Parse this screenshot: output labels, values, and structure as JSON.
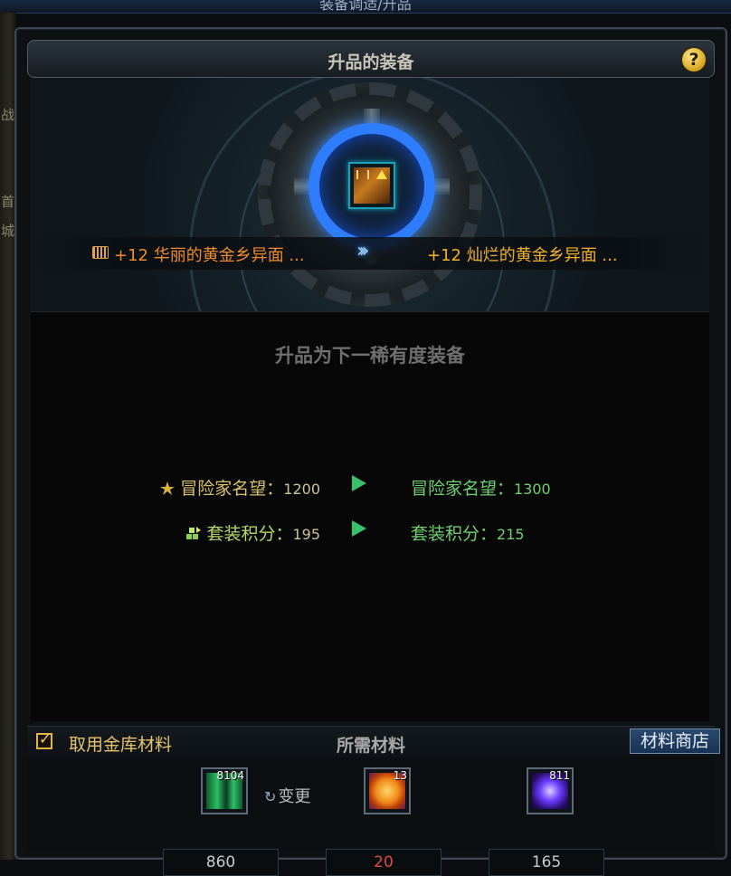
{
  "window": {
    "top_title": "装备调适/升品"
  },
  "sidebar": {
    "glyphs": [
      "战",
      "首",
      "城"
    ]
  },
  "panel": {
    "title": "升品的装备",
    "help": "?"
  },
  "upgrade": {
    "old_item": "+12 华丽的黄金乡异面 ...",
    "arrows": "›››",
    "new_item": "+12 灿烂的黄金乡异面 ..."
  },
  "info": {
    "title": "升品为下一稀有度装备",
    "stats": [
      {
        "label": "冒险家名望：",
        "old": "1200",
        "new_label": "冒险家名望：",
        "new": "1300"
      },
      {
        "label": "套装积分：",
        "old": "195",
        "new_label": "套装积分：",
        "new": "215"
      }
    ]
  },
  "footer": {
    "use_bank_label": "取用金库材料",
    "use_bank_checked": true,
    "required_label": "所需材料",
    "shop_button": "材料商店",
    "change_label": "变更",
    "materials": [
      {
        "count": "8104",
        "quantity": "860",
        "icon": "green-crystal-icon"
      },
      {
        "count": "13",
        "quantity": "20",
        "icon": "orange-orb-icon",
        "insufficient": true
      },
      {
        "count": "811",
        "quantity": "165",
        "icon": "purple-vortex-icon"
      }
    ]
  },
  "colors": {
    "accent_blue": "#2f7dff",
    "old_item": "#f08a2a",
    "new_item": "#f0b02a",
    "increase": "#6fd06f",
    "insufficient": "#e04848"
  }
}
